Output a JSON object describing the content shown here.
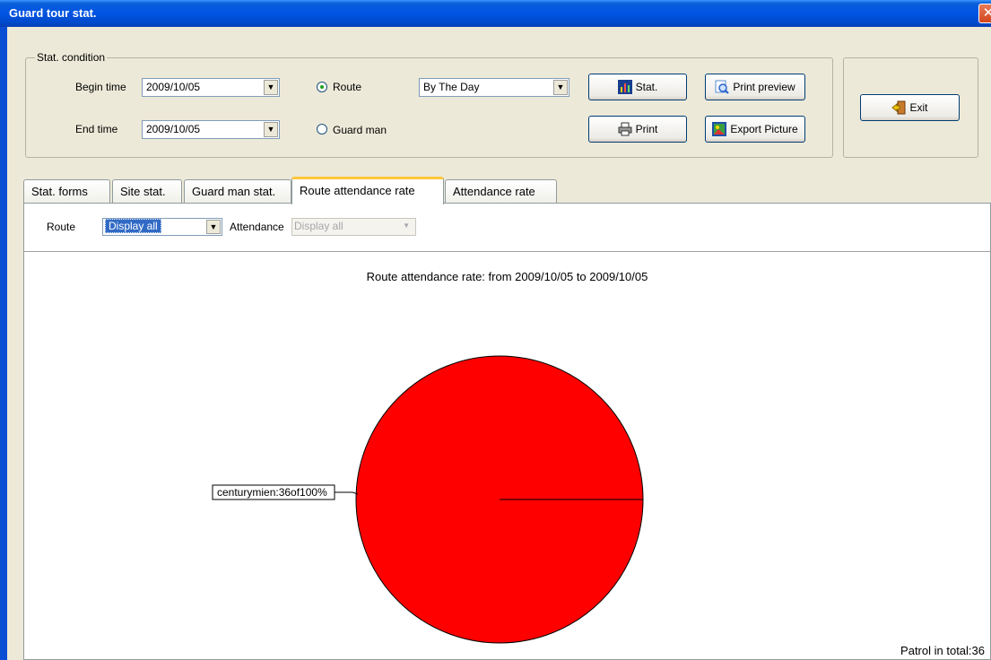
{
  "window": {
    "title": "Guard tour stat."
  },
  "condition": {
    "legend": "Stat. condition",
    "begin_label": "Begin time",
    "begin_value": "2009/10/05",
    "end_label": "End time",
    "end_value": "2009/10/05",
    "route_label": "Route",
    "guard_label": "Guard man",
    "selected_mode": "Route",
    "period_value": "By The Day"
  },
  "buttons": {
    "stat": "Stat.",
    "print_preview": "Print preview",
    "print": "Print",
    "export_picture": "Export Picture",
    "exit": "Exit"
  },
  "tabs": [
    {
      "label": "Stat. forms"
    },
    {
      "label": "Site stat."
    },
    {
      "label": "Guard man stat."
    },
    {
      "label": "Route attendance rate"
    },
    {
      "label": "Attendance rate"
    }
  ],
  "active_tab": "Route attendance rate",
  "filters": {
    "route_label": "Route",
    "route_value": "Display all",
    "attendance_label": "Attendance",
    "attendance_value": "Display all"
  },
  "chart_data": {
    "type": "pie",
    "title": "Route attendance rate:  from 2009/10/05 to 2009/10/05",
    "slices": [
      {
        "label": "centurymien:36of100%",
        "value": 100,
        "count": 36,
        "color": "#ff0000"
      }
    ]
  },
  "summary": {
    "total_label": "Patrol in total:36"
  }
}
